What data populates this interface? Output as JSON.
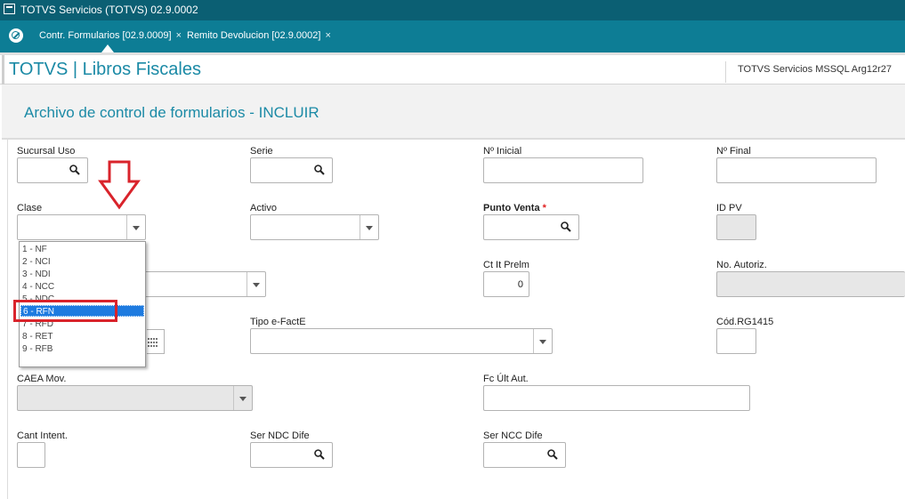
{
  "window": {
    "title": "TOTVS Servicios (TOTVS) 02.9.0002"
  },
  "tabs": [
    {
      "label": "Contr. Formularios [02.9.0009]",
      "close": "×",
      "active": true
    },
    {
      "label": "Remito Devolucion [02.9.0002]",
      "close": "×",
      "active": false
    }
  ],
  "header": {
    "app_title": "TOTVS | Libros Fiscales",
    "server_info": "TOTVS Servicios MSSQL Arg12r27"
  },
  "page": {
    "title": "Archivo de control de formularios - INCLUIR"
  },
  "fields": {
    "sucursal_uso": {
      "label": "Sucursal Uso",
      "value": ""
    },
    "serie": {
      "label": "Serie",
      "value": ""
    },
    "n_inicial": {
      "label": "Nº Inicial",
      "value": ""
    },
    "n_final": {
      "label": "Nº Final",
      "value": ""
    },
    "clase": {
      "label": "Clase",
      "value": ""
    },
    "activo": {
      "label": "Activo",
      "value": ""
    },
    "punto_venta": {
      "label": "Punto Venta",
      "required_mark": "*",
      "value": ""
    },
    "id_pv": {
      "label": "ID PV",
      "value": ""
    },
    "ct_it_prelm": {
      "label": "Ct It Prelm",
      "value": "0"
    },
    "no_autoriz": {
      "label": "No. Autoriz.",
      "value": ""
    },
    "tipo_e_facte": {
      "label": "Tipo e-FactE",
      "value": ""
    },
    "cod_rg1415": {
      "label": "Cód.RG1415",
      "value": ""
    },
    "caea_mov": {
      "label": "CAEA Mov.",
      "value": ""
    },
    "fc_ult_aut": {
      "label": "Fc Últ Aut.",
      "value": ""
    },
    "cant_intent": {
      "label": "Cant Intent.",
      "value": ""
    },
    "ser_ndc_dife": {
      "label": "Ser NDC Dife",
      "value": ""
    },
    "ser_ncc_dife": {
      "label": "Ser NCC Dife",
      "value": ""
    }
  },
  "clase_options": [
    {
      "label": "1 - NF"
    },
    {
      "label": "2 - NCI"
    },
    {
      "label": "3 - NDI"
    },
    {
      "label": "4 - NCC"
    },
    {
      "label": "5 - NDC"
    },
    {
      "label": "6 - RFN",
      "selected": true
    },
    {
      "label": "7 - RFD"
    },
    {
      "label": "8 - RET"
    },
    {
      "label": "9 - RFB"
    }
  ],
  "colors": {
    "accent": "#1b8aa6",
    "titlebar": "#0b5f73",
    "tabbar": "#0d7d95",
    "selection": "#1e7be0",
    "annotation": "#d9232b"
  },
  "icons": {
    "search": "search-icon",
    "dropdown": "chevron-down-icon",
    "calendar": "calendar-icon",
    "home": "home-icon",
    "close": "close-icon"
  }
}
